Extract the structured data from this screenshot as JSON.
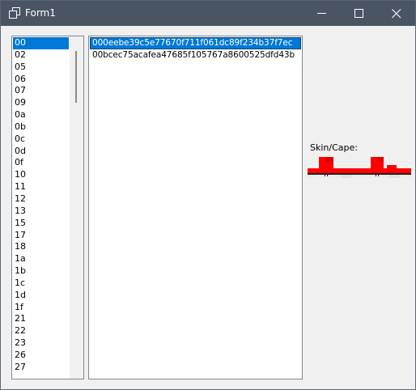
{
  "window": {
    "title": "Form1"
  },
  "ids_list": {
    "items": [
      "00",
      "02",
      "05",
      "06",
      "07",
      "09",
      "0a",
      "0b",
      "0c",
      "0d",
      "0f",
      "10",
      "11",
      "12",
      "13",
      "15",
      "17",
      "18",
      "1a",
      "1b",
      "1c",
      "1d",
      "1f",
      "21",
      "22",
      "23",
      "26",
      "27"
    ],
    "selected_index": 0
  },
  "hashes_list": {
    "items": [
      "000eebe39c5e77670f711f061dc89f234b37f7ec",
      "00bcec75acafea47685f105767a8600525dfd43b"
    ],
    "selected_index": 0
  },
  "skin": {
    "label": "Skin/Cape:"
  },
  "colors": {
    "selection": "#0078d7",
    "titlebar": "#4a5563",
    "skin_red": "#ff0000"
  },
  "icons": [
    "app-icon",
    "minimize-icon",
    "maximize-icon",
    "close-icon"
  ]
}
